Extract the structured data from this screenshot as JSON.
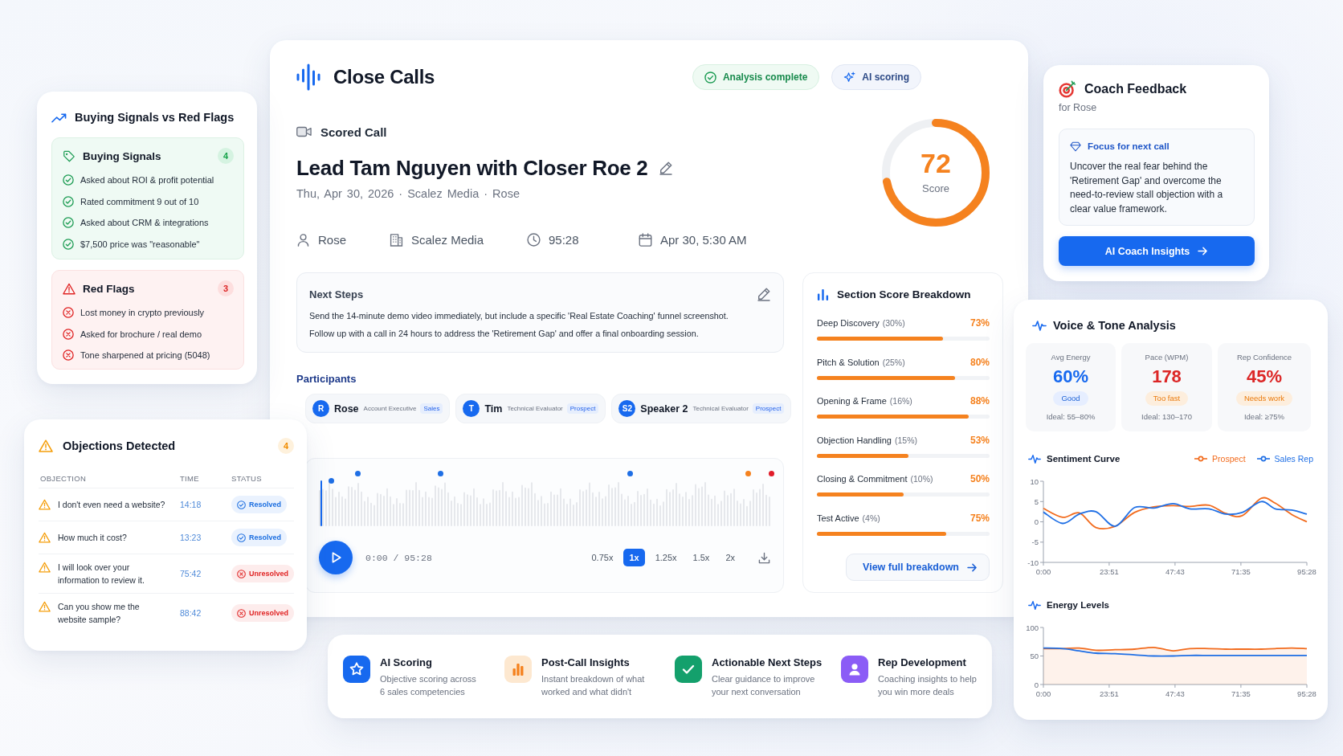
{
  "app": {
    "name": "Close Calls"
  },
  "badges": [
    {
      "kind": "success",
      "label": "Analysis complete"
    },
    {
      "kind": "ai",
      "label": "AI scoring"
    }
  ],
  "call": {
    "label": "Scored Call",
    "title": "Lead Tam Nguyen with Closer Roe 2",
    "subtitle": "Thu, Apr 30, 2026 · Scalez Media · Rose",
    "details": [
      {
        "kind": "person",
        "text": "Rose"
      },
      {
        "kind": "company",
        "text": "Scalez Media"
      },
      {
        "kind": "duration",
        "text": "95:28"
      },
      {
        "kind": "date",
        "text": "Apr 30, 5:30 AM"
      }
    ],
    "score": {
      "value": "72",
      "label": "Score",
      "level": 0.72
    }
  },
  "next_steps": {
    "title": "Next Steps",
    "lines": [
      "Send the 14-minute demo video immediately, but include a specific 'Real Estate Coaching' funnel screenshot.",
      "Follow up with a call in 24 hours to address the 'Retirement Gap' and offer a final onboarding session."
    ]
  },
  "participants": {
    "title": "Participants",
    "items": [
      {
        "initials": "R",
        "name": "Rose",
        "role": "Account Executive",
        "tag": "Sales"
      },
      {
        "initials": "T",
        "name": "Tim",
        "role": "Technical Evaluator",
        "tag": "Prospect"
      },
      {
        "initials": "S2",
        "name": "Speaker 2",
        "role": "Technical Evaluator",
        "tag": "Prospect"
      }
    ]
  },
  "player": {
    "markers": [
      {
        "color": "#1f6fe5"
      },
      {
        "color": "#1f6fe5"
      },
      {
        "color": "#1f6fe5"
      },
      {
        "color": "#1f6fe5"
      },
      {
        "color": "#f5821f"
      },
      {
        "color": "#e11d2a"
      }
    ],
    "time": "0:00 / 95:28",
    "speeds": [
      {
        "label": "0.75x",
        "selected": false
      },
      {
        "label": "1x",
        "selected": true
      },
      {
        "label": "1.25x",
        "selected": false
      },
      {
        "label": "1.5x",
        "selected": false
      },
      {
        "label": "2x",
        "selected": false
      }
    ]
  },
  "section_scores": {
    "title": "Section Score Breakdown",
    "items": [
      {
        "label": "Deep Discovery",
        "weight": "(30%)",
        "value": "73%",
        "level": 0.73
      },
      {
        "label": "Pitch & Solution",
        "weight": "(25%)",
        "value": "80%",
        "level": 0.8
      },
      {
        "label": "Opening & Frame",
        "weight": "(16%)",
        "value": "88%",
        "level": 0.88
      },
      {
        "label": "Objection Handling",
        "weight": "(15%)",
        "value": "53%",
        "level": 0.53
      },
      {
        "label": "Closing & Commitment",
        "weight": "(10%)",
        "value": "50%",
        "level": 0.5
      },
      {
        "label": "Test Active",
        "weight": "(4%)",
        "value": "75%",
        "level": 0.75
      }
    ],
    "button": "View full breakdown"
  },
  "signals": {
    "title": "Buying Signals vs Red Flags",
    "groups": [
      {
        "kind": "positive",
        "title": "Buying Signals",
        "count": "4",
        "items": [
          "Asked about ROI & profit potential",
          "Rated commitment 9 out of 10",
          "Asked about CRM & integrations",
          "$7,500 price was \"reasonable\""
        ]
      },
      {
        "kind": "negative",
        "title": "Red Flags",
        "count": "3",
        "items": [
          "Lost money in crypto previously",
          "Asked for brochure / real demo",
          "Tone sharpened at pricing (5048)"
        ]
      }
    ]
  },
  "objections": {
    "title": "Objections Detected",
    "count": "4",
    "columns": [
      "OBJECTION",
      "TIME",
      "STATUS"
    ],
    "rows": [
      {
        "text": "I don't even need a website?",
        "time": "14:18",
        "status": "Resolved",
        "resolved": true
      },
      {
        "text": "How much it cost?",
        "time": "13:23",
        "status": "Resolved",
        "resolved": true
      },
      {
        "text": "I will look over your information to review it.",
        "time": "75:42",
        "status": "Unresolved",
        "resolved": false
      },
      {
        "text": "Can you show me the website sample?",
        "time": "88:42",
        "status": "Unresolved",
        "resolved": false
      }
    ]
  },
  "coach": {
    "title": "Coach Feedback",
    "subtitle": "for Rose",
    "focus_title": "Focus for next call",
    "focus_text": "Uncover the real fear behind the 'Retirement Gap' and overcome the need-to-review stall objection with a clear value framework.",
    "button": "AI Coach Insights"
  },
  "voice": {
    "title": "Voice & Tone Analysis",
    "metrics": [
      {
        "kind": "good",
        "label": "Avg Energy",
        "value": "60%",
        "rating": "Good",
        "ideal": "Ideal: 55–80%"
      },
      {
        "kind": "warning",
        "label": "Pace (WPM)",
        "value": "178",
        "rating": "Too fast",
        "ideal": "Ideal: 130–170"
      },
      {
        "kind": "warning",
        "label": "Rep Confidence",
        "value": "45%",
        "rating": "Needs work",
        "ideal": "Ideal: ≥75%"
      }
    ],
    "sentiment": {
      "chart_data": {
        "type": "line",
        "title": "Sentiment Curve",
        "x": [
          0,
          7,
          13,
          19,
          26,
          33,
          40,
          47,
          53,
          60,
          66,
          72,
          79,
          84,
          90,
          95.47
        ],
        "xlim": [
          0,
          95.47
        ],
        "ylim": [
          -10,
          10
        ],
        "xticks": [
          {
            "value": 0,
            "label": "0:00"
          },
          {
            "value": 23.85,
            "label": "23:51"
          },
          {
            "value": 47.72,
            "label": "47:43"
          },
          {
            "value": 71.58,
            "label": "71:35"
          },
          {
            "value": 95.47,
            "label": "95:28"
          }
        ],
        "yticks": [
          -10,
          -5,
          0,
          5,
          10
        ],
        "series": [
          {
            "name": "Prospect",
            "color": "#f26b1d",
            "values": [
              3.3,
              1.1,
              2.2,
              -1.4,
              -1.1,
              2.3,
              3.7,
              4.0,
              3.8,
              4.1,
              2.1,
              1.5,
              5.8,
              4.6,
              1.8,
              0
            ]
          },
          {
            "name": "Sales Rep",
            "color": "#1f6fe5",
            "values": [
              2.4,
              -0.4,
              1.9,
              2.5,
              -1.1,
              3.5,
              3.4,
              4.5,
              3.2,
              3.2,
              1.9,
              2.3,
              5.0,
              3.2,
              2.9,
              1.9
            ]
          }
        ]
      }
    },
    "energy": {
      "chart_data": {
        "type": "area",
        "title": "Energy Levels",
        "x": [
          0,
          7,
          13,
          19,
          26,
          33,
          40,
          47,
          53,
          60,
          66,
          72,
          79,
          84,
          90,
          95.47
        ],
        "xlim": [
          0,
          95.47
        ],
        "ylim": [
          0,
          100
        ],
        "xticks": [
          {
            "value": 0,
            "label": "0:00"
          },
          {
            "value": 23.85,
            "label": "23:51"
          },
          {
            "value": 47.72,
            "label": "47:43"
          },
          {
            "value": 71.58,
            "label": "71:35"
          },
          {
            "value": 95.47,
            "label": "95:28"
          }
        ],
        "yticks": [
          0,
          50,
          100
        ],
        "series": [
          {
            "color": "#f26b1d",
            "values": [
              63,
              63,
              64,
              60,
              61,
              62,
              65,
              59,
              63,
              63,
              62,
              62,
              62,
              63,
              64,
              63
            ]
          },
          {
            "type": "line",
            "color": "#1f6fe5",
            "values": [
              64,
              63,
              59,
              55,
              54,
              52,
              50,
              50,
              51,
              51,
              51,
              51,
              51,
              51,
              51,
              51
            ]
          }
        ]
      }
    }
  },
  "features": [
    {
      "kind": "scoring",
      "title": "AI Scoring",
      "text": "Objective scoring across 6 sales competencies"
    },
    {
      "kind": "insights",
      "title": "Post-Call Insights",
      "text": "Instant breakdown of what worked and what didn't"
    },
    {
      "kind": "steps",
      "title": "Actionable Next Steps",
      "text": "Clear guidance to improve your next conversation"
    },
    {
      "kind": "development",
      "title": "Rep Development",
      "text": "Coaching insights to help you win more deals"
    }
  ]
}
